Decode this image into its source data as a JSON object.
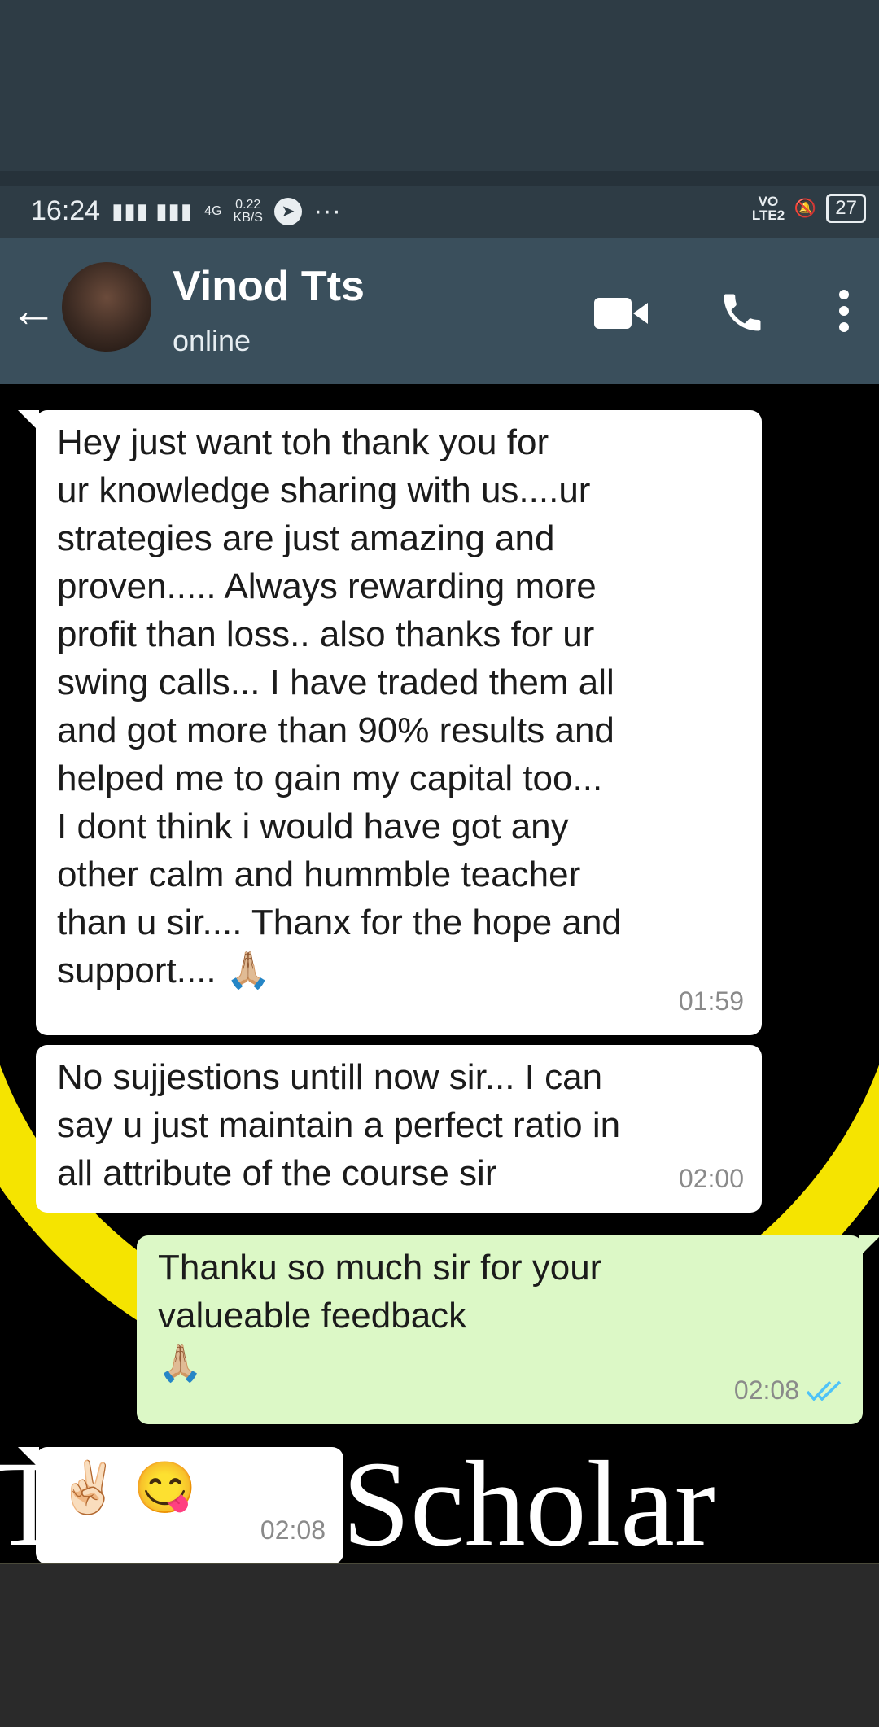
{
  "status_bar": {
    "time": "16:24",
    "network": "4G",
    "speed_value": "0.22",
    "speed_unit": "KB/S",
    "overflow": "···",
    "volte": "VO LTE2",
    "battery": "27"
  },
  "header": {
    "contact_name": "Vinod Tts",
    "contact_status": "online"
  },
  "background_text": "T ding Scholar",
  "messages": [
    {
      "direction": "incoming",
      "text": "Hey just want toh thank you for\nur knowledge sharing with us....ur\nstrategies are just amazing and\nproven..... Always rewarding more\nprofit than loss.. also thanks for ur\nswing calls... I have traded them all\nand got more than 90% results and\nhelped me to gain my capital too...\nI dont think i would have got any\nother calm and hummble teacher\nthan u sir.... Thanx for the hope and\nsupport.... 🙏🏼",
      "time": "01:59"
    },
    {
      "direction": "incoming",
      "text": "No sujjestions untill now sir... I can\nsay u just maintain a perfect ratio in\nall attribute of the course sir",
      "time": "02:00"
    },
    {
      "direction": "outgoing",
      "text": "Thanku so much sir for your\nvalueable feedback\n🙏🏼",
      "time": "02:08",
      "read_status": "double-check-read"
    },
    {
      "direction": "incoming",
      "text": "✌🏻 😋",
      "time": "02:08"
    }
  ],
  "colors": {
    "appbar": "#3a4f5c",
    "incoming_bubble": "#ffffff",
    "outgoing_bubble": "#dcf8c6",
    "read_ticks": "#4fc3f7"
  }
}
